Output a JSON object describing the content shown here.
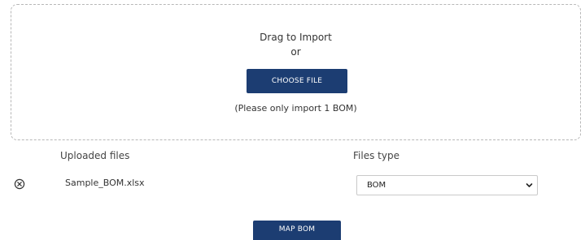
{
  "dropzone": {
    "title": "Drag to Import",
    "or_text": "or",
    "choose_button_label": "CHOOSE FILE",
    "hint": "(Please only import 1 BOM)"
  },
  "uploads": {
    "files_header": "Uploaded files",
    "type_header": "Files type",
    "rows": [
      {
        "filename": "Sample_BOM.xlsx",
        "type": "BOM",
        "remove_icon": "circle-x-icon"
      }
    ]
  },
  "actions": {
    "map_button_label": "MAP BOM"
  },
  "colors": {
    "primary": "#1c3d72",
    "dropzone_border": "#b7b7b7"
  }
}
